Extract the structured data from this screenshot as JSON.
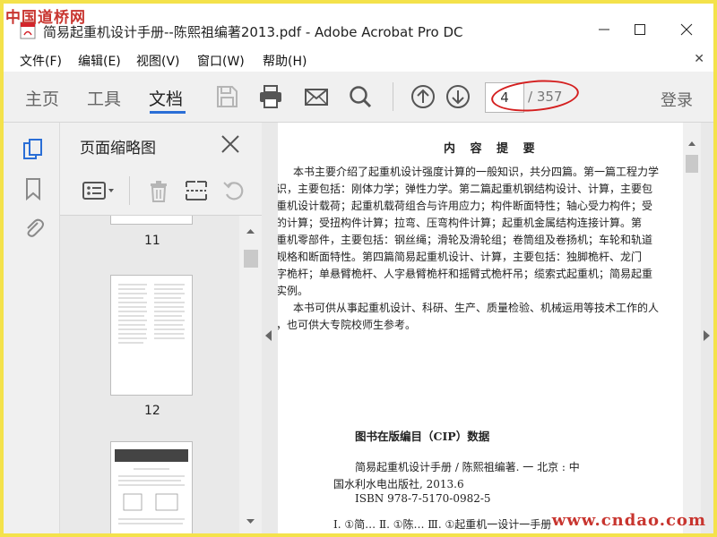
{
  "watermark": {
    "top": "中国道桥网",
    "bottom": "www.cndao.com"
  },
  "window": {
    "title": "简易起重机设计手册--陈熙祖编著2013.pdf - Adobe Acrobat Pro DC"
  },
  "menu": {
    "items": [
      "文件(F)",
      "编辑(E)",
      "视图(V)",
      "窗口(W)",
      "帮助(H)"
    ]
  },
  "toolbar": {
    "tabs": {
      "home": "主页",
      "tools": "工具",
      "document": "文档"
    },
    "current_page": "4",
    "total_pages": "/ 357",
    "login": "登录"
  },
  "thumb_panel": {
    "title": "页面缩略图",
    "pages": [
      "11",
      "12"
    ]
  },
  "doc": {
    "heading": "内 容 提 要",
    "intro_lines": [
      "本书主要介绍了起重机设计强度计算的一般知识，共分四篇。第一篇工程力学",
      "识，主要包括：刚体力学；弹性力学。第二篇起重机钢结构设计、计算，主要包",
      "重机设计载荷；起重机载荷组合与许用应力；构件断面特性；轴心受力构件；受",
      "的计算；受扭构件计算；拉弯、压弯构件计算；起重机金属结构连接计算。第",
      "重机零部件，主要包括：钢丝绳；滑轮及滑轮组；卷筒组及卷扬机；车轮和轨道",
      "规格和断面特性。第四篇简易起重机设计、计算，主要包括：独脚桅杆、龙门",
      "字桅杆；单悬臂桅杆、人字悬臂桅杆和摇臂式桅杆吊；缆索式起重机；简易起重",
      "实例。",
      "本书可供从事起重机设计、科研、生产、质量检验、机械运用等技术工作的人",
      "，也可供大专院校师生参考。"
    ],
    "cip": {
      "title": "图书在版编目（CIP）数据",
      "line1": "简易起重机设计手册 / 陈熙祖编著. 一 北京 : 中",
      "line2": "国水利水电出版社, 2013.6",
      "line3": "ISBN 978-7-5170-0982-5",
      "line4": "Ⅰ. ①简… Ⅱ. ①陈… Ⅲ. ①起重机一设计一手册"
    }
  },
  "colors": {
    "accent": "#2a6ed6",
    "annotation": "#d41f1f",
    "frame": "#f4e24b"
  }
}
